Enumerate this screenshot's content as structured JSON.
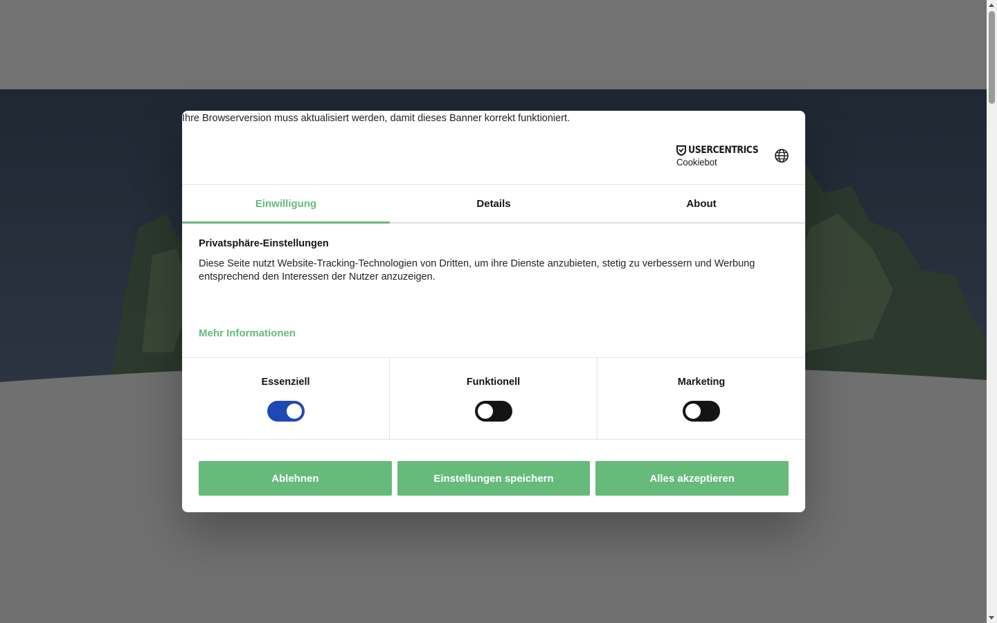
{
  "banner": {
    "warning": "Ihre Browserversion muss aktualisiert werden, damit dieses Banner korrekt funktioniert.",
    "brand": {
      "name": "USERCENTRICS",
      "product": "Cookiebot"
    },
    "tabs": [
      {
        "label": "Einwilligung",
        "active": true
      },
      {
        "label": "Details",
        "active": false
      },
      {
        "label": "About",
        "active": false
      }
    ],
    "privacy": {
      "title": "Privatsphäre-Einstellungen",
      "text": "Diese Seite nutzt Website-Tracking-Technologien von Dritten, um ihre Dienste anzubieten, stetig zu verbessern und Werbung entsprechend den Interessen der Nutzer anzuzeigen."
    },
    "more_info": "Mehr Informationen",
    "categories": [
      {
        "label": "Essenziell",
        "enabled": true
      },
      {
        "label": "Funktionell",
        "enabled": false
      },
      {
        "label": "Marketing",
        "enabled": false
      }
    ],
    "buttons": {
      "reject": "Ablehnen",
      "save": "Einstellungen speichern",
      "accept_all": "Alles akzeptieren"
    }
  },
  "colors": {
    "accent": "#66bb7a",
    "toggle_on": "#1f48b7",
    "toggle_off": "#141414"
  },
  "icons": {
    "language": "globe-icon",
    "brand": "shield-icon"
  }
}
